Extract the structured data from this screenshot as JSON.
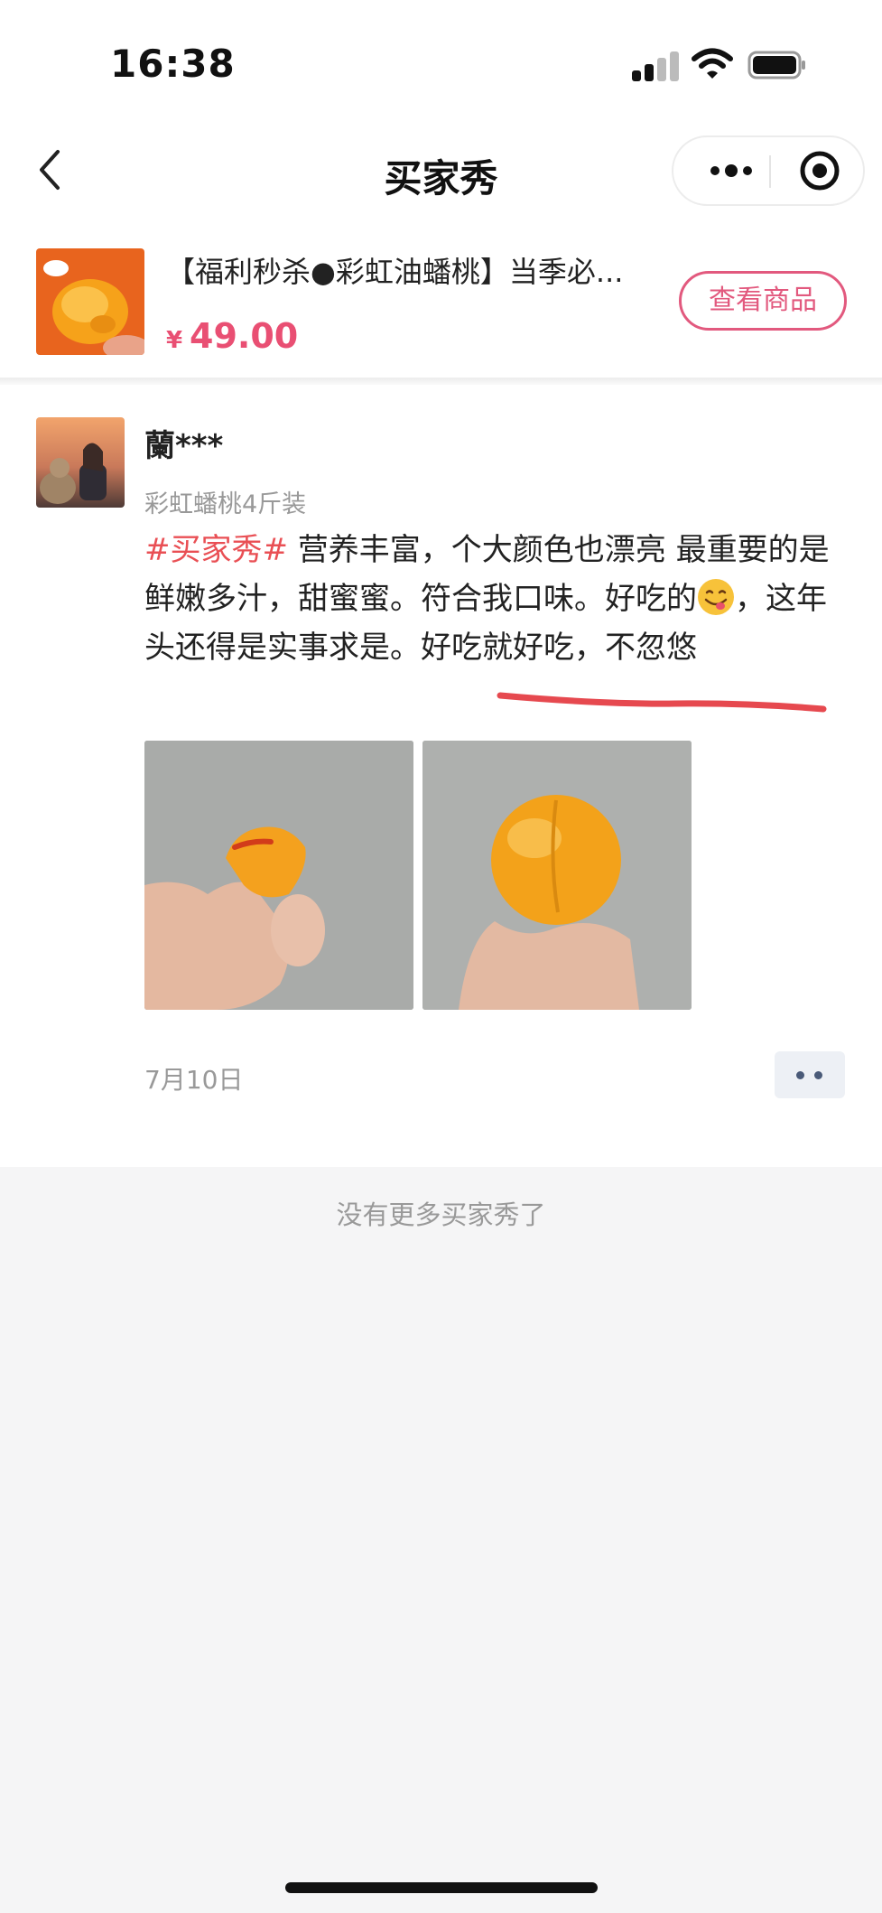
{
  "status_bar": {
    "time": "16:38"
  },
  "nav": {
    "title": "买家秀"
  },
  "product": {
    "title": "【福利秒杀●彩虹油蟠桃】当季必...",
    "currency": "¥",
    "price": "49.00",
    "view_button": "查看商品"
  },
  "review": {
    "username": "蘭***",
    "spec": "彩虹蟠桃4斤装",
    "hashtag": "#买家秀#",
    "text_part1": " 营养丰富，个大颜色也漂亮 最重要的是鲜嫩多汁，甜蜜蜜。符合我口味。好吃的",
    "text_part2": "，这年头还得是实事求是。好吃就好吃，不忽悠",
    "date": "7月10日"
  },
  "footer": {
    "no_more": "没有更多买家秀了"
  },
  "colors": {
    "accent": "#e94f73",
    "hashtag": "#e94f54",
    "underline": "#e6494f"
  }
}
